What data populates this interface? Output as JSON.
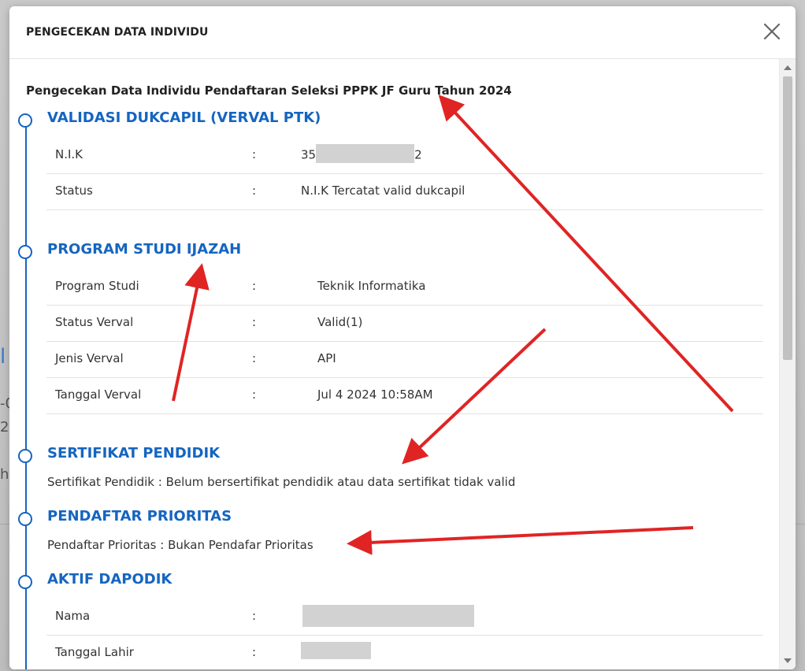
{
  "modal": {
    "title": "PENGECEKAN DATA INDIVIDU",
    "heading": "Pengecekan Data Individu Pendaftaran Seleksi PPPK JF Guru Tahun 2024"
  },
  "background": {
    "fragments": [
      "l",
      "-0",
      "2",
      "h"
    ]
  },
  "sections": {
    "dukcapil": {
      "title": "VALIDASI DUKCAPIL (VERVAL PTK)",
      "rows": [
        {
          "label": "N.I.K",
          "sep": ":",
          "value_prefix": "35",
          "value_suffix": "2"
        },
        {
          "label": "Status",
          "sep": ":",
          "value": "N.I.K Tercatat valid dukcapil"
        }
      ]
    },
    "ijazah": {
      "title": "PROGRAM STUDI IJAZAH",
      "rows": [
        {
          "label": "Program Studi",
          "sep": ":",
          "value": "Teknik Informatika"
        },
        {
          "label": "Status Verval",
          "sep": ":",
          "value": "Valid(1)"
        },
        {
          "label": "Jenis Verval",
          "sep": ":",
          "value": "API"
        },
        {
          "label": "Tanggal Verval",
          "sep": ":",
          "value": "Jul 4 2024 10:58AM"
        }
      ]
    },
    "sertifikat": {
      "title": "SERTIFIKAT PENDIDIK",
      "text": "Sertifikat Pendidik : Belum bersertifikat pendidik atau data sertifikat tidak valid"
    },
    "prioritas": {
      "title": "PENDAFTAR PRIORITAS",
      "text": "Pendaftar Prioritas : Bukan Pendafar Prioritas"
    },
    "dapodik": {
      "title": "AKTIF DAPODIK",
      "rows": [
        {
          "label": "Nama",
          "sep": ":"
        },
        {
          "label": "Tanggal Lahir",
          "sep": ":"
        }
      ]
    }
  },
  "colors": {
    "accent": "#1565c0",
    "annotation_arrow": "#e02424"
  },
  "icons": {
    "close": "close-icon"
  }
}
